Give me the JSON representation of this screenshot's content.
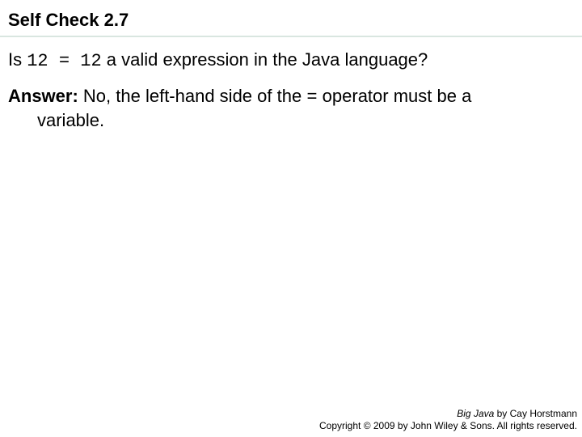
{
  "title": "Self Check 2.7",
  "question": {
    "prefix": "Is ",
    "code": "12 = 12",
    "suffix": " a valid expression in the Java language?"
  },
  "answer": {
    "label": "Answer:",
    "line1_part1": " No, the left-hand side of the",
    "code": "=",
    "line1_part2": "operator must be a",
    "line2": "variable."
  },
  "footer": {
    "book_title": "Big Java",
    "byline": " by Cay Horstmann",
    "copyright": "Copyright © 2009 by John Wiley & Sons. All rights reserved."
  }
}
